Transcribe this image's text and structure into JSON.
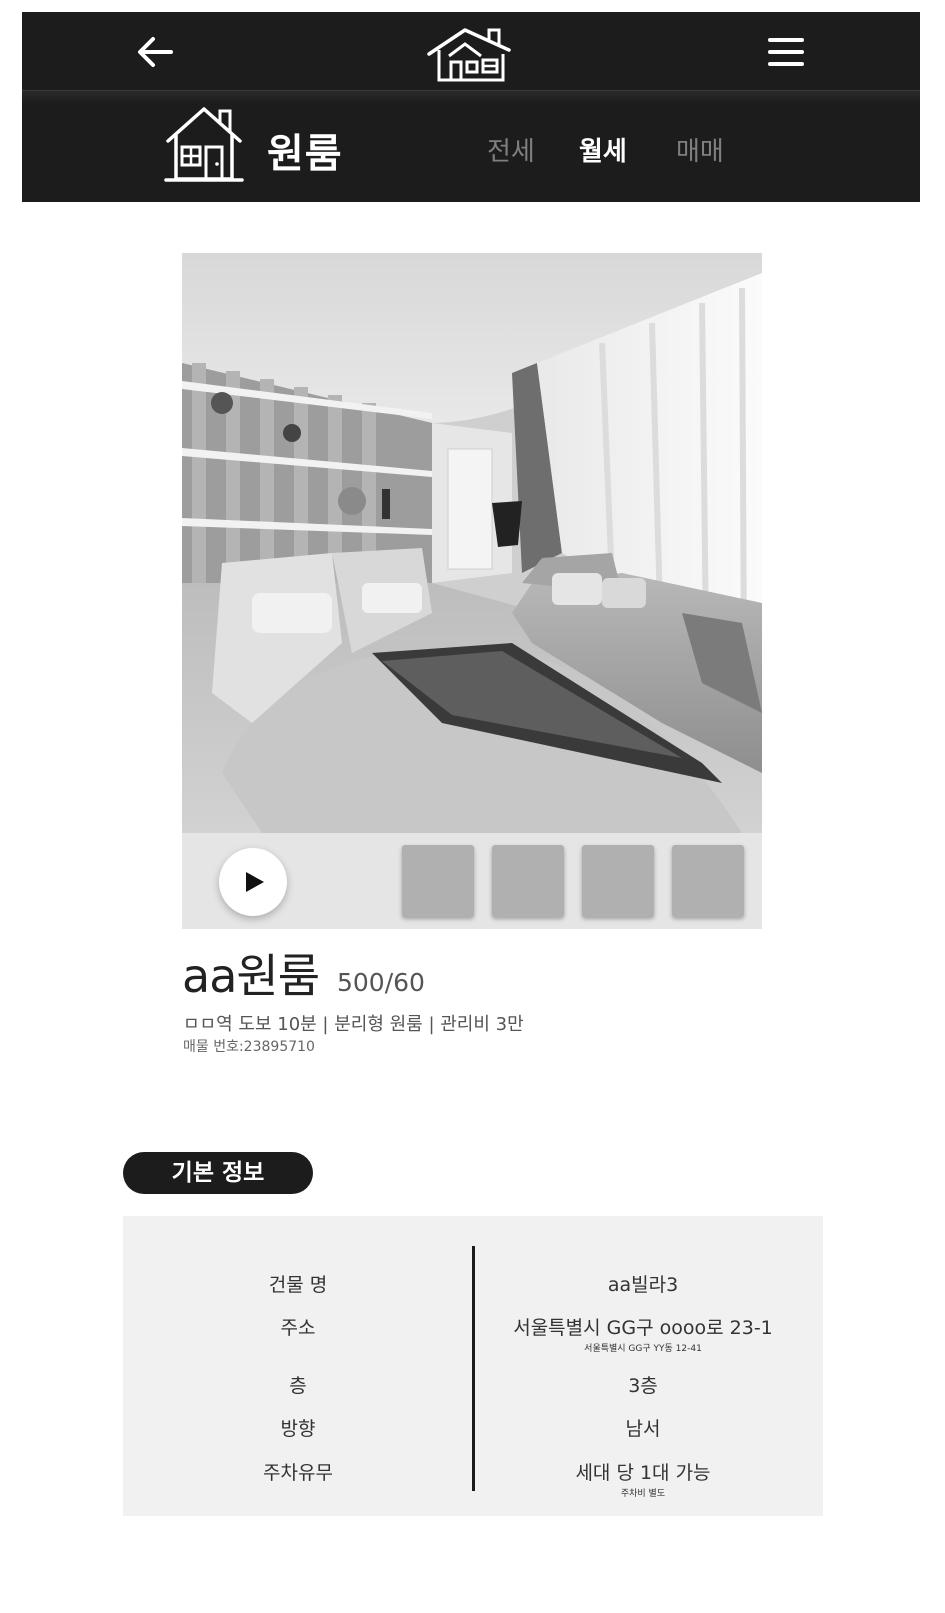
{
  "header": {
    "back_icon": "back-arrow-icon",
    "logo_icon": "house-logo-icon",
    "menu_icon": "hamburger-menu-icon"
  },
  "subheader": {
    "category_icon": "house-icon",
    "category_title": "원룸",
    "tabs": [
      {
        "label": "전세",
        "active": false
      },
      {
        "label": "월세",
        "active": true
      },
      {
        "label": "매매",
        "active": false
      }
    ]
  },
  "gallery": {
    "play_icon": "play-icon",
    "thumbnail_count": 4
  },
  "listing": {
    "name": "aa원룸",
    "price": "500/60",
    "summary": "ㅁㅁ역 도보 10분 | 분리형 원룸 | 관리비 3만",
    "id_text": "매물 번호:23895710"
  },
  "basic_info": {
    "title": "기본 정보",
    "rows": [
      {
        "label": "건물 명",
        "value": "aa빌라3",
        "sub": ""
      },
      {
        "label": "주소",
        "value": "서울특별시 GG구 oooo로 23-1",
        "sub": "서울특별시 GG구 YY동 12-41"
      },
      {
        "label": "층",
        "value": "3층",
        "sub": ""
      },
      {
        "label": "방향",
        "value": "남서",
        "sub": ""
      },
      {
        "label": "주차유무",
        "value": "세대 당 1대 가능",
        "sub": "주차비 별도"
      }
    ]
  },
  "colors": {
    "bar": "#1c1c1c",
    "tab_active": "#ffffff",
    "tab_inactive": "#7f7f7f",
    "info_bg": "#f1f1f1"
  }
}
